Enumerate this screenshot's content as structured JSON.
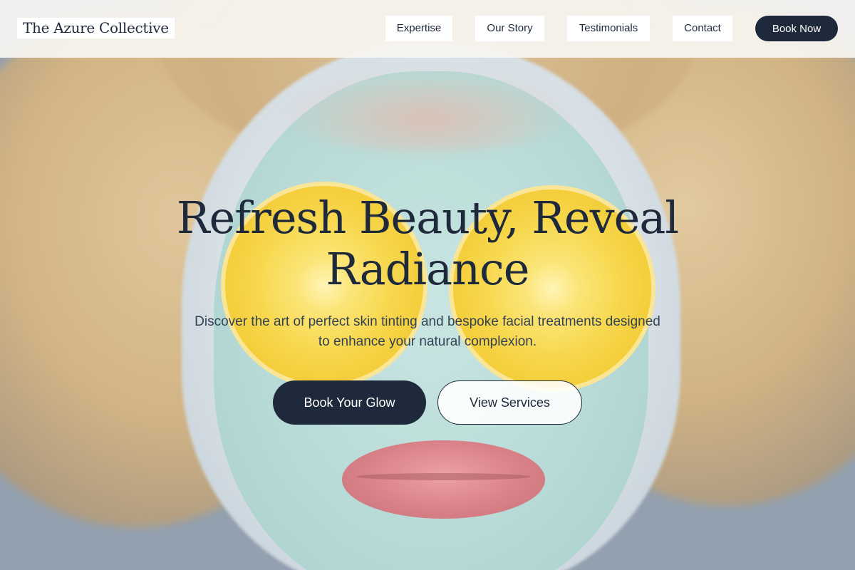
{
  "brand": {
    "name": "The Azure Collective"
  },
  "nav": {
    "items": [
      {
        "label": "Expertise"
      },
      {
        "label": "Our Story"
      },
      {
        "label": "Testimonials"
      },
      {
        "label": "Contact"
      }
    ],
    "cta_label": "Book Now"
  },
  "hero": {
    "title": "Refresh Beauty, Reveal Radiance",
    "subtitle": "Discover the art of perfect skin tinting and bespoke facial treatments designed to enhance your natural complexion.",
    "primary_cta": "Book Your Glow",
    "secondary_cta": "View Services",
    "image_subject": "woman-with-clay-mask-and-lemon-slices"
  },
  "colors": {
    "primary": "#1e293b",
    "header_bg": "#f7f5f1",
    "text_muted": "#334155"
  }
}
